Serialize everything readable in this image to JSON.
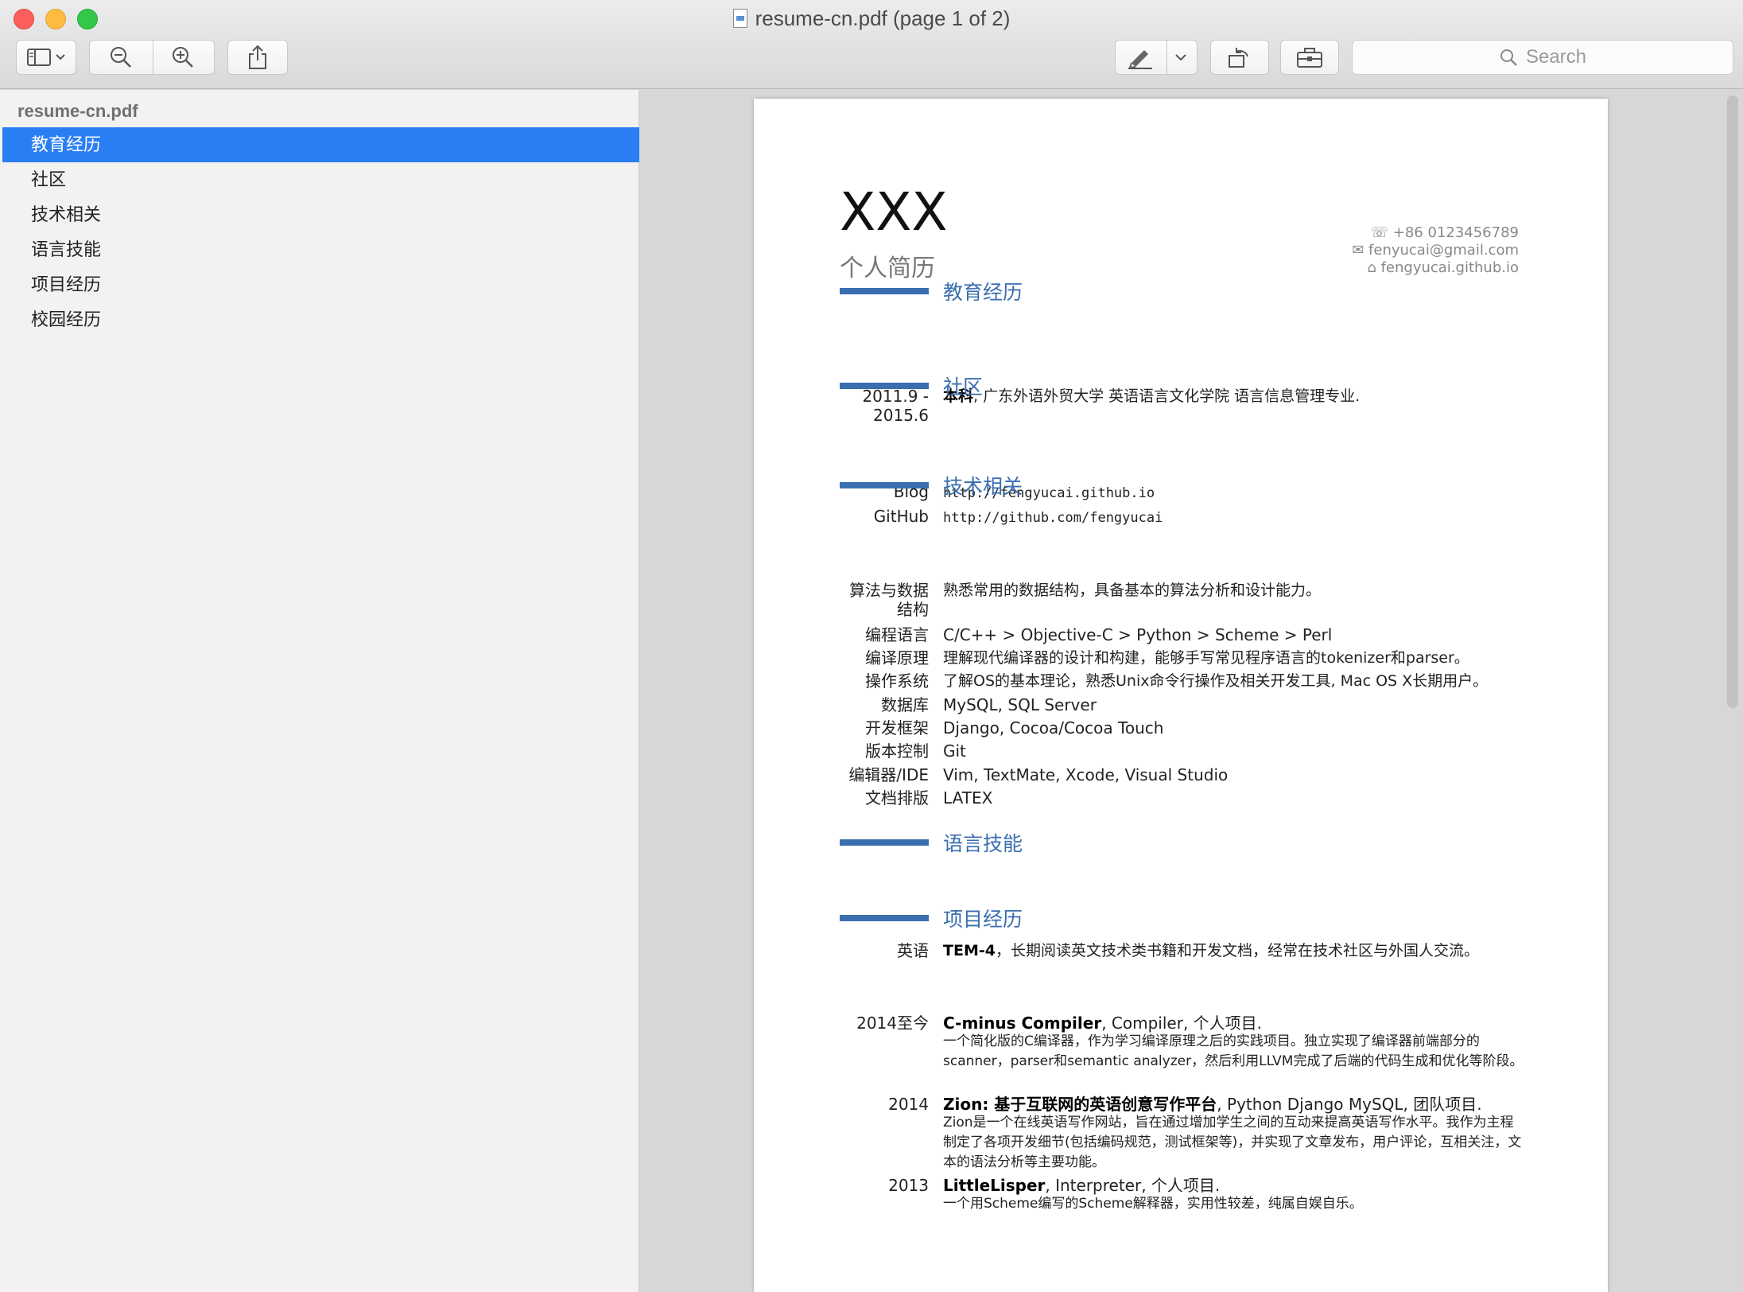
{
  "window": {
    "title": "resume-cn.pdf (page 1 of 2)"
  },
  "toolbar": {
    "search_placeholder": "Search"
  },
  "sidebar": {
    "file": "resume-cn.pdf",
    "items": [
      {
        "label": "教育经历",
        "selected": true
      },
      {
        "label": "社区",
        "selected": false
      },
      {
        "label": "技术相关",
        "selected": false
      },
      {
        "label": "语言技能",
        "selected": false
      },
      {
        "label": "项目经历",
        "selected": false
      },
      {
        "label": "校园经历",
        "selected": false
      }
    ]
  },
  "resume": {
    "name": "XXX",
    "subtitle": "个人简历",
    "phone": "+86 0123456789",
    "email": "fenyucai@gmail.com",
    "site": "fengyucai.github.io",
    "education": {
      "title": "教育经历",
      "date_start": "2011.9 -",
      "date_end": "2015.6",
      "degree": "本科",
      "detail": ", 广东外语外贸大学 英语语言文化学院 语言信息管理专业."
    },
    "community": {
      "title": "社区",
      "rows": [
        {
          "label": "Blog",
          "value": "http://fengyucai.github.io"
        },
        {
          "label": "GitHub",
          "value": "http://github.com/fengyucai"
        }
      ]
    },
    "tech": {
      "title": "技术相关",
      "algo_label_1": "算法与数据",
      "algo_label_2": "结构",
      "algo_value": "熟悉常用的数据结构，具备基本的算法分析和设计能力。",
      "rows": [
        {
          "label": "编程语言",
          "value": "C/C++ > Objective-C > Python > Scheme > Perl"
        },
        {
          "label": "编译原理",
          "value": "理解现代编译器的设计和构建，能够手写常见程序语言的tokenizer和parser。"
        },
        {
          "label": "操作系统",
          "value": "了解OS的基本理论，熟悉Unix命令行操作及相关开发工具, Mac OS X长期用户。"
        },
        {
          "label": "数据库",
          "value": "MySQL, SQL Server"
        },
        {
          "label": "开发框架",
          "value": "Django, Cocoa/Cocoa Touch"
        },
        {
          "label": "版本控制",
          "value": "Git"
        },
        {
          "label": "编辑器/IDE",
          "value": "Vim, TextMate, Xcode, Visual Studio"
        },
        {
          "label": "文档排版",
          "value": "LATEX"
        }
      ]
    },
    "language": {
      "title": "语言技能",
      "label": "英语",
      "bold": "TEM-4",
      "detail": "，长期阅读英文技术类书籍和开发文档，经常在技术社区与外国人交流。"
    },
    "projects": {
      "title": "项目经历",
      "items": [
        {
          "date": "2014至今",
          "name": "C-minus Compiler",
          "meta": ", Compiler, 个人项目.",
          "desc": "一个简化版的C编译器，作为学习编译原理之后的实践项目。独立实现了编译器前端部分的scanner，parser和semantic analyzer，然后利用LLVM完成了后端的代码生成和优化等阶段。"
        },
        {
          "date": "2014",
          "name": "Zion: 基于互联网的英语创意写作平台",
          "meta": ", Python Django MySQL, 团队项目.",
          "desc": "Zion是一个在线英语写作网站，旨在通过增加学生之间的互动来提高英语写作水平。我作为主程制定了各项开发细节(包括编码规范，测试框架等)，并实现了文章发布，用户评论，互相关注，文本的语法分析等主要功能。"
        },
        {
          "date": "2013",
          "name": "LittleLisper",
          "meta": ", Interpreter, 个人项目.",
          "desc": "一个用Scheme编写的Scheme解释器，实用性较差，纯属自娱自乐。"
        }
      ]
    }
  },
  "colors": {
    "accent": "#3a6eb0",
    "selection": "#2a7ef4"
  }
}
